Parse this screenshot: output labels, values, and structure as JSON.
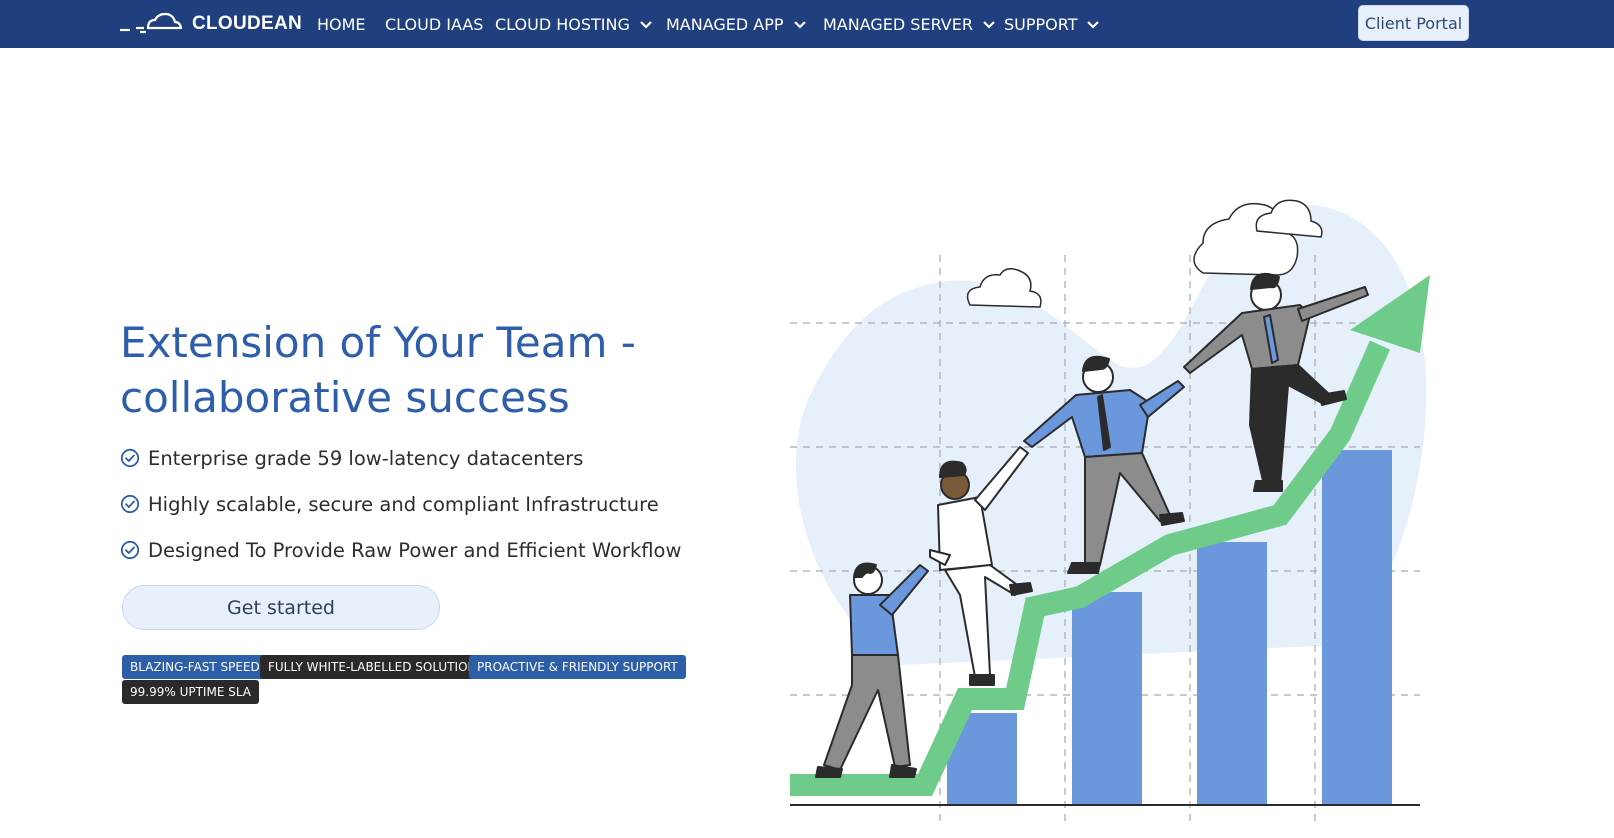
{
  "brand": {
    "name": "CLOUDEAN",
    "logo_icon": "cloud-logo-icon"
  },
  "nav": {
    "items": [
      {
        "label": "HOME",
        "has_dropdown": false
      },
      {
        "label": "CLOUD IAAS",
        "has_dropdown": false
      },
      {
        "label": "CLOUD HOSTING",
        "has_dropdown": true
      },
      {
        "label": "MANAGED APP",
        "has_dropdown": true
      },
      {
        "label": "MANAGED SERVER",
        "has_dropdown": true
      },
      {
        "label": "SUPPORT",
        "has_dropdown": true
      }
    ],
    "client_portal_label": "Client Portal"
  },
  "hero": {
    "title_line1": "Extension of Your Team -",
    "title_line2": "collaborative success",
    "features": [
      "Enterprise grade 59 low-latency datacenters",
      "Highly scalable, secure and compliant Infrastructure",
      "Designed To Provide Raw Power and Efficient Workflow"
    ],
    "cta_label": "Get started",
    "badges": [
      {
        "label": "BLAZING-FAST SPEED",
        "style": "blue"
      },
      {
        "label": "FULLY WHITE-LABELLED SOLUTION",
        "style": "dark"
      },
      {
        "label": "PROACTIVE & FRIENDLY SUPPORT",
        "style": "blue"
      },
      {
        "label": "99.99% UPTIME SLA",
        "style": "dark"
      }
    ]
  },
  "illustration": {
    "icon": "team-climbing-growth-chart-illustration"
  },
  "colors": {
    "navbar": "#1f3f7e",
    "title": "#2e5eab",
    "badge_blue": "#2d5ea8",
    "badge_dark": "#2a2a2a",
    "chart_bar": "#6b98dc",
    "growth_arrow": "#6fcb8a",
    "blob": "#e6f0fb"
  }
}
